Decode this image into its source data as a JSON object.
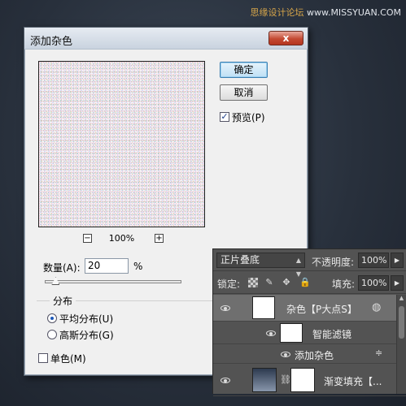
{
  "watermark": {
    "cn": "思缘设计论坛",
    "url": "www.MISSYUAN.COM"
  },
  "dialog": {
    "title": "添加杂色",
    "close_label": "x",
    "ok_label": "确定",
    "cancel_label": "取消",
    "preview_label": "预览(P)",
    "preview_checked": true,
    "zoom_out": "−",
    "zoom_in": "+",
    "zoom_value": "100%",
    "amount_label": "数量(A):",
    "amount_value": "20",
    "amount_unit": "%",
    "amount_level_percent": 20,
    "distribution": {
      "legend": "分布",
      "options": [
        {
          "label": "平均分布(U)",
          "selected": true
        },
        {
          "label": "高斯分布(G)",
          "selected": false
        }
      ]
    },
    "monochrome_label": "单色(M)",
    "monochrome_checked": false
  },
  "layers_panel": {
    "blend_mode": "正片叠底",
    "opacity_label": "不透明度:",
    "opacity_value": "100%",
    "lock_label": "锁定:",
    "fill_label": "填充:",
    "fill_value": "100%",
    "layers": [
      {
        "name": "杂色【P大点S】",
        "selected": true
      },
      {
        "name": "智能滤镜"
      },
      {
        "name": "添加杂色"
      },
      {
        "name": "渐变填充【..."
      }
    ]
  },
  "colors": {
    "background": "#28303c",
    "dialog_bg": "#f0f0f0",
    "close_button": "#c44a33",
    "panel_bg": "#535353",
    "selected_layer": "#6f6f6f"
  }
}
